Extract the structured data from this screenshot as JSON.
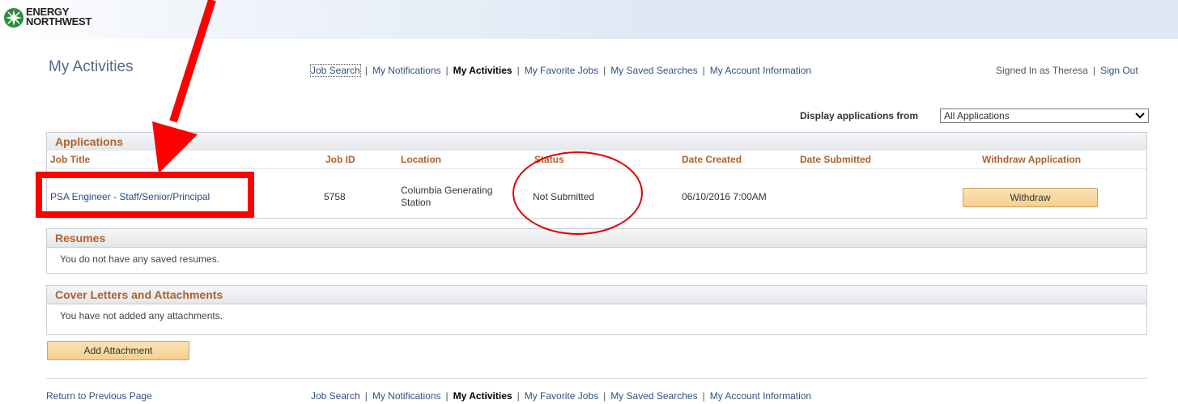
{
  "brand": {
    "logo_line1": "ENERGY",
    "logo_line2": "NORTHWEST"
  },
  "page": {
    "title": "My Activities"
  },
  "nav": {
    "items": [
      "Job Search",
      "My Notifications",
      "My Activities",
      "My Favorite Jobs",
      "My Saved Searches",
      "My Account Information"
    ],
    "current": "My Activities",
    "separator": "|"
  },
  "user": {
    "signed_in_text": "Signed In as Theresa",
    "sign_out": "Sign Out"
  },
  "filter": {
    "label": "Display applications from",
    "selected": "All Applications"
  },
  "applications": {
    "section_title": "Applications",
    "columns": [
      "Job Title",
      "Job ID",
      "Location",
      "Status",
      "Date Created",
      "Date Submitted",
      "Withdraw Application"
    ],
    "rows": [
      {
        "job_title": "PSA Engineer - Staff/Senior/Principal",
        "job_id": "5758",
        "location_line1": "Columbia Generating",
        "location_line2": "Station",
        "status": "Not Submitted",
        "date_created": "06/10/2016  7:00AM",
        "date_submitted": "",
        "withdraw_label": "Withdraw"
      }
    ]
  },
  "resumes": {
    "section_title": "Resumes",
    "message": "You do not have any saved resumes."
  },
  "cover_letters": {
    "section_title": "Cover Letters and Attachments",
    "message": "You have not added any attachments.",
    "add_button": "Add Attachment"
  },
  "footer": {
    "return_link": "Return to Previous Page"
  },
  "colors": {
    "annotation": "#ff0000",
    "section_header_text": "#b0612c",
    "link": "#2b4a84",
    "button": "#f6d08f"
  },
  "icons": {
    "dropdown": "chevron-down-icon",
    "logo": "energy-northwest-logo"
  }
}
